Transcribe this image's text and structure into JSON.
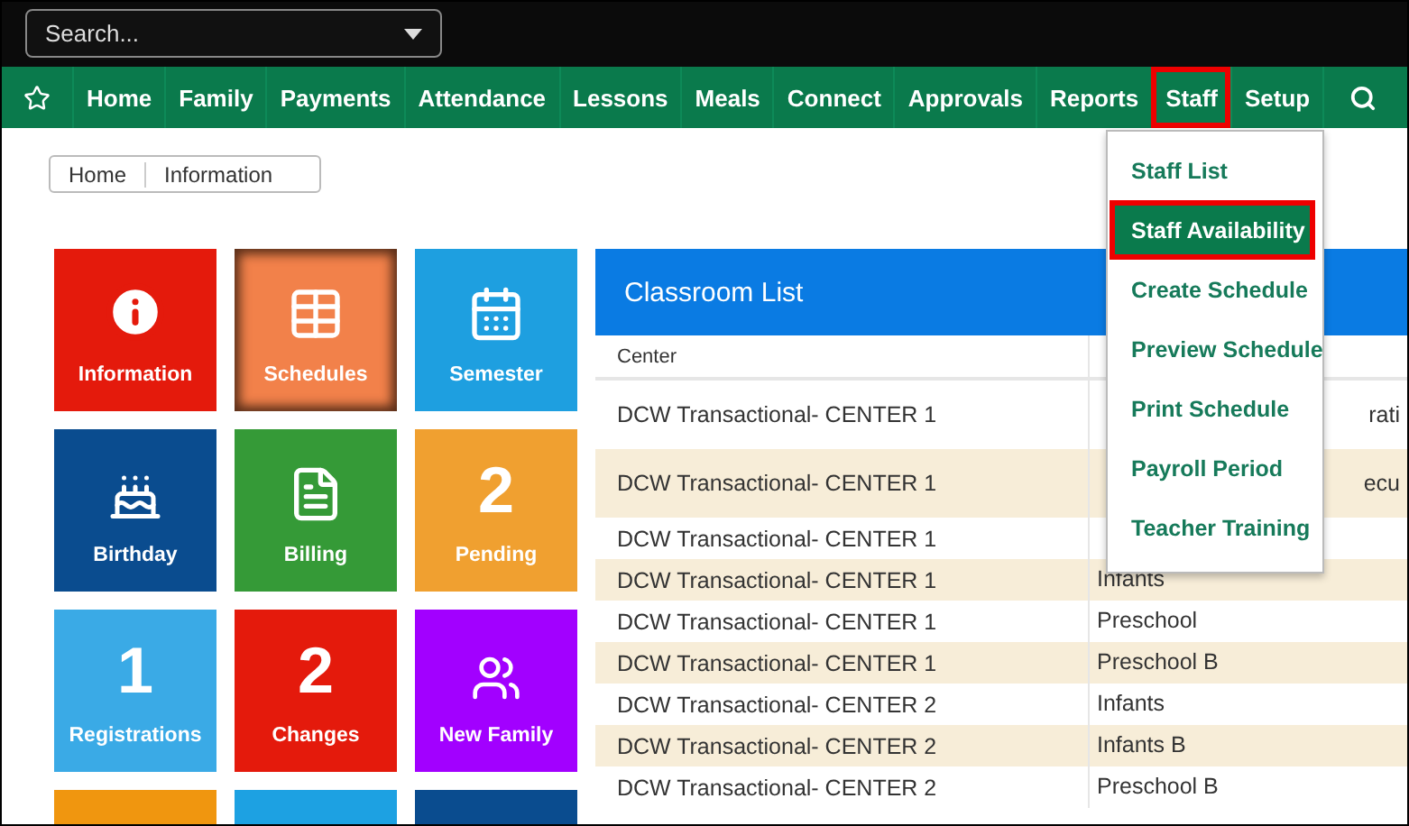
{
  "search": {
    "placeholder": "Search..."
  },
  "nav": [
    {
      "label": "Home",
      "selected": false
    },
    {
      "label": "Family",
      "selected": false
    },
    {
      "label": "Payments",
      "selected": false
    },
    {
      "label": "Attendance",
      "selected": false
    },
    {
      "label": "Lessons",
      "selected": false
    },
    {
      "label": "Meals",
      "selected": false
    },
    {
      "label": "Connect",
      "selected": false
    },
    {
      "label": "Approvals",
      "selected": false
    },
    {
      "label": "Reports",
      "selected": false
    },
    {
      "label": "Staff",
      "selected": true
    },
    {
      "label": "Setup",
      "selected": false
    }
  ],
  "breadcrumb": [
    "Home",
    "Information"
  ],
  "tiles": [
    {
      "kind": "info",
      "label": "Information",
      "color": "#e41a0c",
      "selected": false
    },
    {
      "kind": "schedule",
      "label": "Schedules",
      "color": "#f2814a",
      "selected": true
    },
    {
      "kind": "calendar",
      "label": "Semester",
      "color": "#1e9fe0",
      "selected": false
    },
    {
      "kind": "cake",
      "label": "Birthday",
      "color": "#0a4c8f",
      "selected": false
    },
    {
      "kind": "bill",
      "label": "Billing",
      "color": "#359a37",
      "selected": false
    },
    {
      "kind": "number",
      "value": "2",
      "label": "Pending",
      "color": "#f0a030",
      "selected": false
    },
    {
      "kind": "number",
      "value": "1",
      "label": "Registrations",
      "color": "#3aaae6",
      "selected": false
    },
    {
      "kind": "number",
      "value": "2",
      "label": "Changes",
      "color": "#e41a0c",
      "selected": false
    },
    {
      "kind": "family",
      "label": "New Family",
      "color": "#a200ff",
      "selected": false
    },
    {
      "kind": "blank",
      "color": "#f0960f",
      "selected": false
    },
    {
      "kind": "blank",
      "color": "#1da1e2",
      "selected": false
    },
    {
      "kind": "blank",
      "color": "#0a4c8f",
      "selected": false
    }
  ],
  "classroom_list": {
    "title": "Classroom List",
    "columns": [
      "Center"
    ],
    "rows": [
      {
        "center": "DCW Transactional- CENTER 1",
        "column_2": {
          "right": "rati"
        }
      },
      {
        "center": "DCW Transactional- CENTER 1",
        "column_2": {
          "right": "ecu"
        }
      },
      {
        "center": "DCW Transactional- CENTER 1"
      },
      {
        "center": "DCW Transactional- CENTER 1",
        "column_2": {
          "left": [
            "Infants"
          ]
        }
      },
      {
        "center": "DCW Transactional- CENTER 1",
        "column_2": {
          "left": [
            "Preschool"
          ]
        }
      },
      {
        "center": "DCW Transactional- CENTER 1",
        "column_2": {
          "left": [
            "Preschool B"
          ]
        }
      },
      {
        "center": "DCW Transactional- CENTER 2",
        "column_2": {
          "left": [
            "Infants"
          ]
        }
      },
      {
        "center": "DCW Transactional- CENTER 2",
        "column_2": {
          "left": [
            "Infants B"
          ]
        }
      },
      {
        "center": "DCW Transactional- CENTER 2",
        "column_2": {
          "left": [
            "Preschool B"
          ]
        }
      }
    ]
  },
  "staff_menu": [
    {
      "label": "Staff List",
      "selected": false
    },
    {
      "label": "Staff Availability",
      "selected": true
    },
    {
      "label": "Create Schedule",
      "selected": false
    },
    {
      "label": "Preview Schedule",
      "selected": false
    },
    {
      "label": "Print Schedule",
      "selected": false
    },
    {
      "label": "Payroll Period",
      "selected": false
    },
    {
      "label": "Teacher Training",
      "selected": false
    }
  ]
}
